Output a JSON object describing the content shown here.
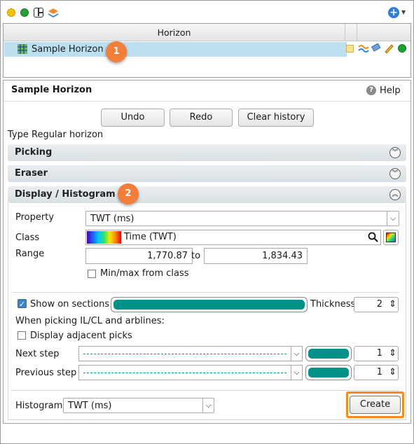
{
  "table": {
    "header": "Horizon",
    "rows": [
      {
        "name": "Sample Horizon"
      }
    ]
  },
  "badges": [
    "1",
    "2"
  ],
  "panel": {
    "title": "Sample Horizon",
    "help_label": "Help",
    "buttons": {
      "undo": "Undo",
      "redo": "Redo",
      "clear_history": "Clear history"
    },
    "type_text": "Type Regular horizon",
    "sections": {
      "picking": "Picking",
      "eraser": "Eraser",
      "display": "Display / Histogram"
    },
    "display": {
      "property_label": "Property",
      "property_value": "TWT (ms)",
      "class_label": "Class",
      "class_value": "Time (TWT)",
      "range_label": "Range",
      "range_min": "1,770.87",
      "range_to": "to",
      "range_max": "1,834.43",
      "minmax_label": "Min/max from class",
      "minmax_checked": false,
      "show_on_sections_label": "Show on sections",
      "show_on_sections_checked": true,
      "section_color": "#00928a",
      "thickness_label": "Thickness",
      "thickness_value": "2",
      "picking_note": "When picking IL/CL and arblines:",
      "adjacent_label": "Display adjacent picks",
      "adjacent_checked": false,
      "next_step_label": "Next step",
      "next_step_value": "1",
      "previous_step_label": "Previous step",
      "previous_step_value": "1",
      "histogram_label": "Histogram",
      "histogram_value": "TWT (ms)",
      "create_label": "Create"
    }
  },
  "colors": {
    "accent_teal": "#00928a",
    "badge_orange": "#f27e3a",
    "selection": "#bde0f1"
  }
}
